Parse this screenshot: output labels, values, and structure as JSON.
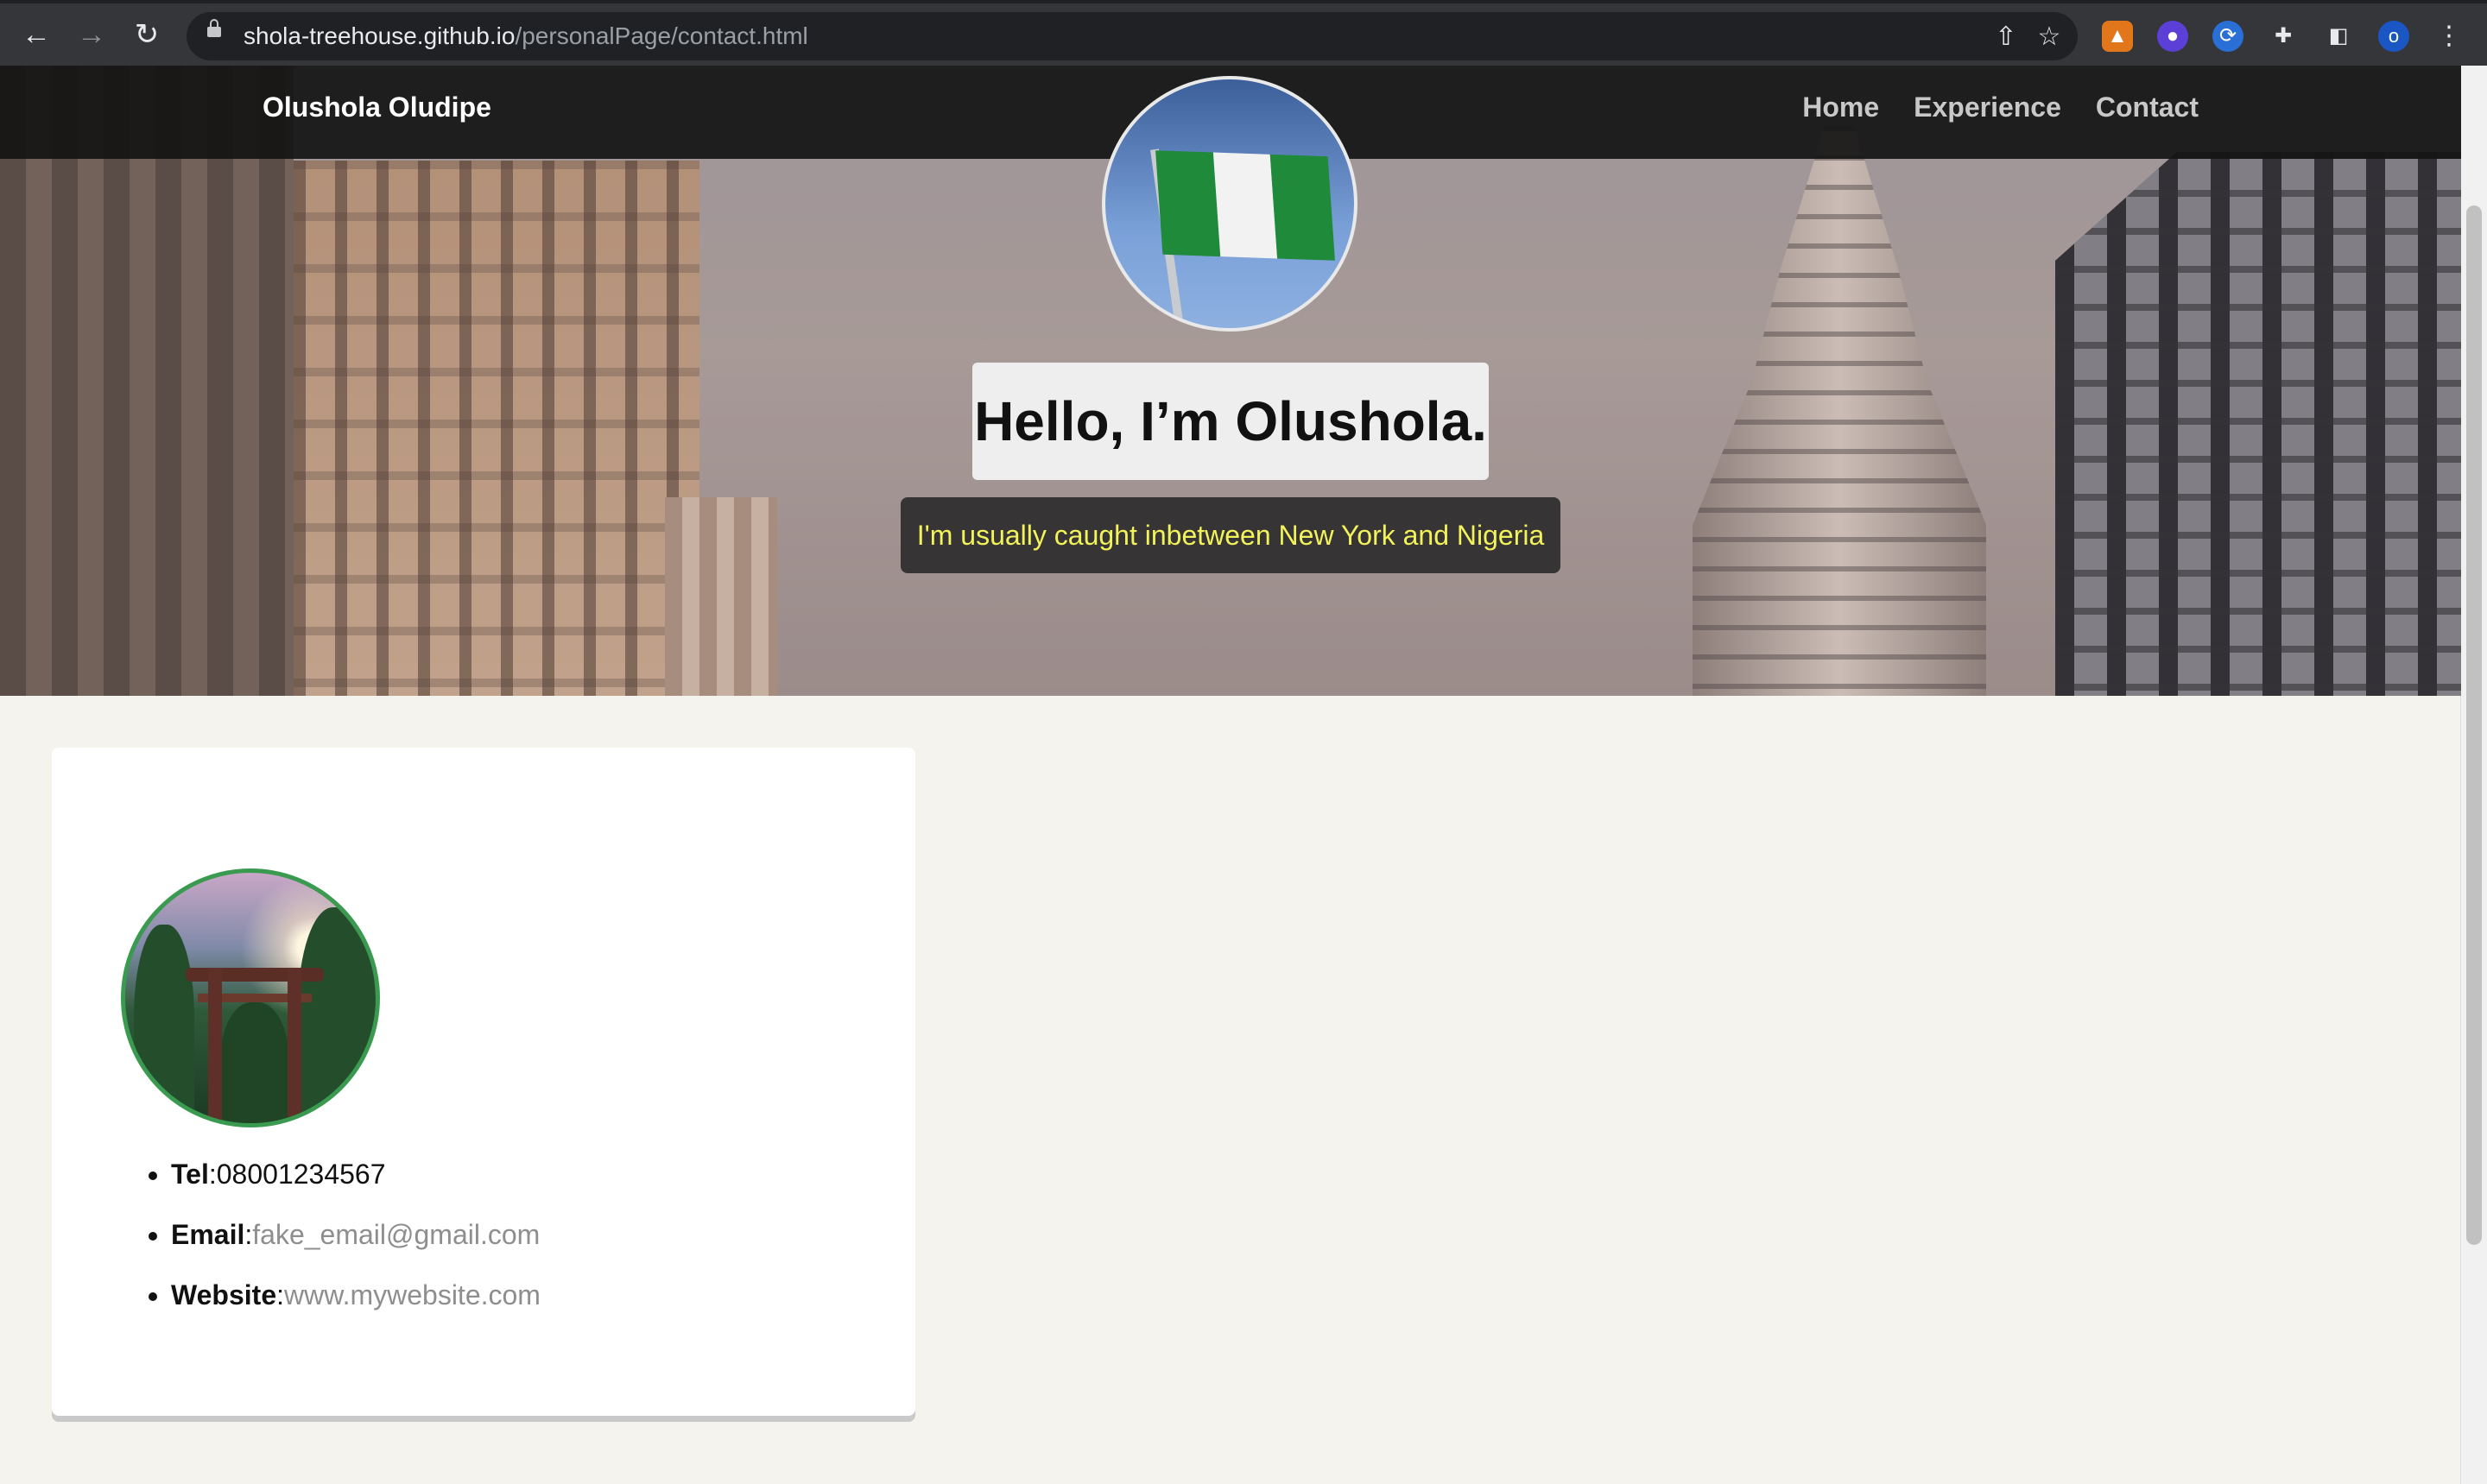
{
  "browser": {
    "url_host": "shola-treehouse.github.io",
    "url_path": "/personalPage/contact.html",
    "profile_initial": "o",
    "icons": [
      "back-icon",
      "forward-icon",
      "reload-icon",
      "lock-icon",
      "share-icon",
      "star-icon",
      "metamask-icon",
      "extension-ghost-icon",
      "extension-sync-icon",
      "puzzle-icon",
      "sidepanel-icon",
      "profile-avatar",
      "menu-icon"
    ]
  },
  "nav": {
    "brand": "Olushola Oludipe",
    "links": [
      "Home",
      "Experience",
      "Contact"
    ]
  },
  "hero": {
    "title": "Hello, I’m Olushola.",
    "subtitle": "I'm usually caught inbetween New York and Nigeria"
  },
  "contact": {
    "items": [
      {
        "label": "Tel",
        "sep": ":",
        "value": "08001234567"
      },
      {
        "label": "Email",
        "sep": ":",
        "value": "fake_email@gmail.com"
      },
      {
        "label": "Website",
        "sep": ":",
        "value": "www.mywebsite.com"
      }
    ]
  },
  "colors": {
    "nav_bg": "#141414",
    "subtitle_text": "#f2f25a",
    "avatar_ring": "#3a9a4f",
    "page_bg": "#f4f3ee"
  }
}
